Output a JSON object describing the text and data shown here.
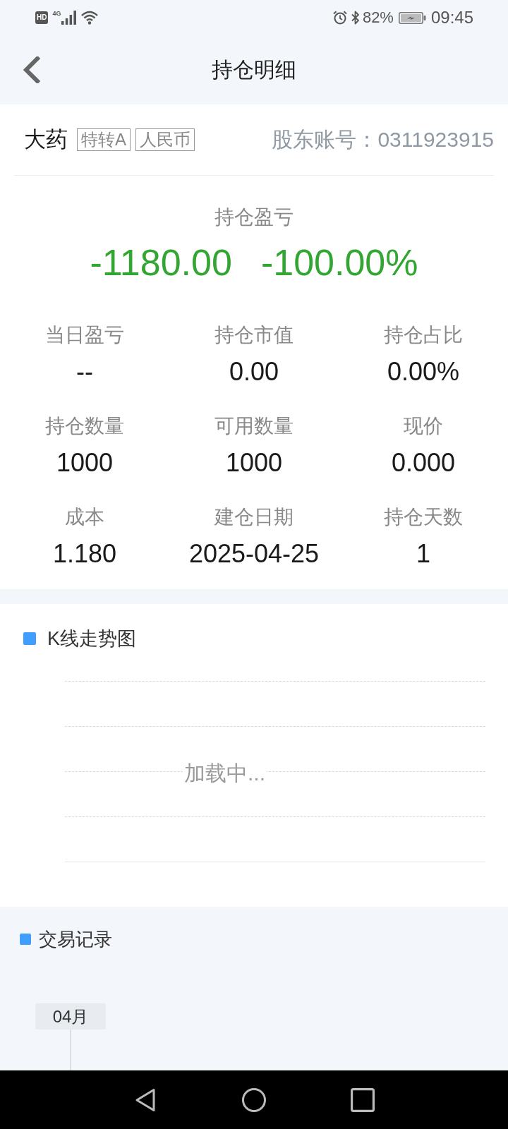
{
  "status_bar": {
    "hd": "HD",
    "network": "4G",
    "battery": "82%",
    "time": "09:45"
  },
  "header": {
    "title": "持仓明细"
  },
  "account": {
    "name": "大药",
    "tags": [
      "特转A",
      "人民币"
    ],
    "account_no": "股东账号：0311923915"
  },
  "pnl": {
    "label": "持仓盈亏",
    "amount": "-1180.00",
    "percent": "-100.00%"
  },
  "stats": [
    {
      "label": "当日盈亏",
      "value": "--"
    },
    {
      "label": "持仓市值",
      "value": "0.00"
    },
    {
      "label": "持仓占比",
      "value": "0.00%"
    },
    {
      "label": "持仓数量",
      "value": "1000"
    },
    {
      "label": "可用数量",
      "value": "1000"
    },
    {
      "label": "现价",
      "value": "0.000"
    },
    {
      "label": "成本",
      "value": "1.180"
    },
    {
      "label": "建仓日期",
      "value": "2025-04-25"
    },
    {
      "label": "持仓天数",
      "value": "1"
    }
  ],
  "kline": {
    "title": "K线走势图",
    "loading": "加载中..."
  },
  "trades": {
    "title": "交易记录",
    "months": [
      "04月"
    ]
  }
}
